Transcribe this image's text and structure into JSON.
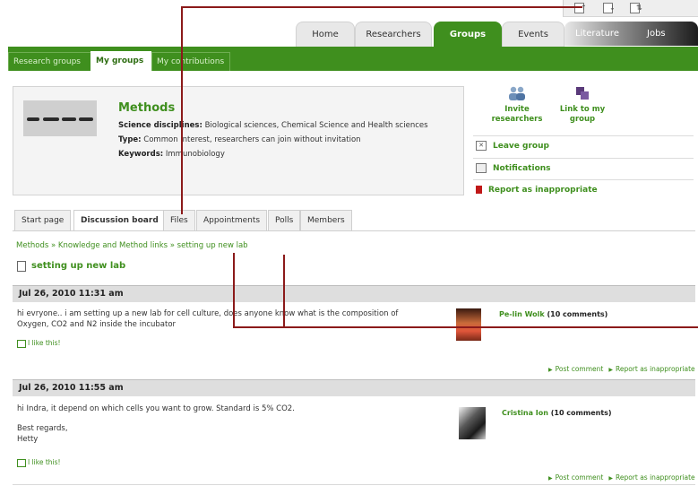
{
  "top_icons": [
    "page-export-icon",
    "page-import-icon",
    "page-sort-icon"
  ],
  "nav": {
    "tabs": [
      "Home",
      "Researchers",
      "Groups",
      "Events",
      "Literature",
      "Jobs"
    ],
    "active": "Groups"
  },
  "subnav": {
    "tabs": [
      "Research groups",
      "My groups",
      "My contributions"
    ],
    "active": "My groups"
  },
  "group": {
    "title": "Methods",
    "disciplines_label": "Science disciplines:",
    "disciplines": "Biological sciences, Chemical Science and Health sciences",
    "type_label": "Type:",
    "type": "Common interest, researchers can join without invitation",
    "keywords_label": "Keywords:",
    "keywords": "Immunobiology"
  },
  "actions": {
    "invite": "Invite researchers",
    "link": "Link to my group",
    "leave": "Leave group",
    "notifications": "Notifications",
    "report": "Report as inappropriate"
  },
  "content_tabs": [
    "Start page",
    "Discussion board",
    "Files",
    "Appointments",
    "Polls",
    "Members"
  ],
  "content_active": "Discussion board",
  "breadcrumb": "Methods » Knowledge and Method links » setting up new lab",
  "topic": "setting up new lab",
  "posts": [
    {
      "date": "Jul 26, 2010 11:31 am",
      "text": "hi evryone.. i am setting up a new lab for cell culture, does anyone know what is the composition of Oxygen, CO2 and N2 inside the incubator",
      "like": "I like this!",
      "author": "Pe-lin Wolk",
      "comments": "(10 comments)",
      "post_comment": "Post comment",
      "report": "Report as inappropriate"
    },
    {
      "date": "Jul 26, 2010 11:55 am",
      "text_lines": [
        "hi Indra, it depend on which cells you want to grow. Standard is 5% CO2.",
        "",
        "Best regards,",
        "Hetty"
      ],
      "like": "I like this!",
      "author": "Cristina Ion",
      "comments": "(10 comments)",
      "post_comment": "Post comment",
      "report": "Report as inappropriate"
    }
  ],
  "colors": {
    "brand_green": "#3f8f1e",
    "annotation_red": "#8b1a1a"
  }
}
